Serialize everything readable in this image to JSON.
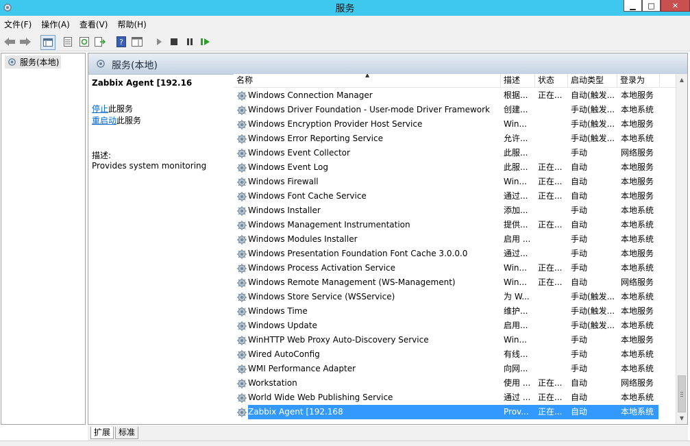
{
  "window": {
    "title": "服务"
  },
  "menu": {
    "items": [
      "文件(F)",
      "操作(A)",
      "查看(V)",
      "帮助(H)"
    ]
  },
  "tree": {
    "root_label": "服务(本地)"
  },
  "header": {
    "title": "服务(本地)"
  },
  "description": {
    "service_name": "Zabbix Agent [192.16",
    "stop_link": "停止",
    "stop_suffix": "此服务",
    "restart_link": "重启动",
    "restart_suffix": "此服务",
    "desc_label": "描述:",
    "desc_text": "Provides system monitoring"
  },
  "table": {
    "columns": [
      "名称",
      "描述",
      "状态",
      "启动类型",
      "登录为"
    ],
    "rows": [
      [
        "Windows Connection Manager",
        "根据...",
        "正在...",
        "自动(触发...",
        "本地服务"
      ],
      [
        "Windows Driver Foundation - User-mode Driver Framework",
        "创建...",
        "",
        "手动(触发...",
        "本地系统"
      ],
      [
        "Windows Encryption Provider Host Service",
        "Win...",
        "",
        "手动(触发...",
        "本地服务"
      ],
      [
        "Windows Error Reporting Service",
        "允许...",
        "",
        "手动(触发...",
        "本地系统"
      ],
      [
        "Windows Event Collector",
        "此服...",
        "",
        "手动",
        "网络服务"
      ],
      [
        "Windows Event Log",
        "此服...",
        "正在...",
        "自动",
        "本地服务"
      ],
      [
        "Windows Firewall",
        "Win...",
        "正在...",
        "自动",
        "本地服务"
      ],
      [
        "Windows Font Cache Service",
        "通过...",
        "正在...",
        "自动",
        "本地服务"
      ],
      [
        "Windows Installer",
        "添加...",
        "",
        "手动",
        "本地系统"
      ],
      [
        "Windows Management Instrumentation",
        "提供...",
        "正在...",
        "自动",
        "本地系统"
      ],
      [
        "Windows Modules Installer",
        "启用 ...",
        "",
        "手动",
        "本地系统"
      ],
      [
        "Windows Presentation Foundation Font Cache 3.0.0.0",
        "通过...",
        "",
        "手动",
        "本地服务"
      ],
      [
        "Windows Process Activation Service",
        "Win...",
        "正在...",
        "手动",
        "本地系统"
      ],
      [
        "Windows Remote Management (WS-Management)",
        "Win...",
        "正在...",
        "自动",
        "网络服务"
      ],
      [
        "Windows Store Service (WSService)",
        "为 W...",
        "",
        "手动(触发...",
        "本地系统"
      ],
      [
        "Windows Time",
        "维护...",
        "",
        "手动(触发...",
        "本地服务"
      ],
      [
        "Windows Update",
        "启用...",
        "",
        "手动(触发...",
        "本地系统"
      ],
      [
        "WinHTTP Web Proxy Auto-Discovery Service",
        "Win...",
        "",
        "手动",
        "本地服务"
      ],
      [
        "Wired AutoConfig",
        "有线...",
        "",
        "手动",
        "本地系统"
      ],
      [
        "WMI Performance Adapter",
        "向网...",
        "",
        "手动",
        "本地系统"
      ],
      [
        "Workstation",
        "使用 ...",
        "正在...",
        "自动",
        "网络服务"
      ],
      [
        "World Wide Web Publishing Service",
        "通过 ...",
        "正在...",
        "自动",
        "本地系统"
      ],
      [
        "Zabbix Agent [192.168",
        "Prov...",
        "正在...",
        "自动",
        "本地系统"
      ]
    ],
    "selected_index": 22
  },
  "tabs": [
    "扩展",
    "标准"
  ],
  "colors": {
    "title_bar": "#3fc8ee",
    "selection": "#3399ff",
    "link": "#0066cc"
  }
}
